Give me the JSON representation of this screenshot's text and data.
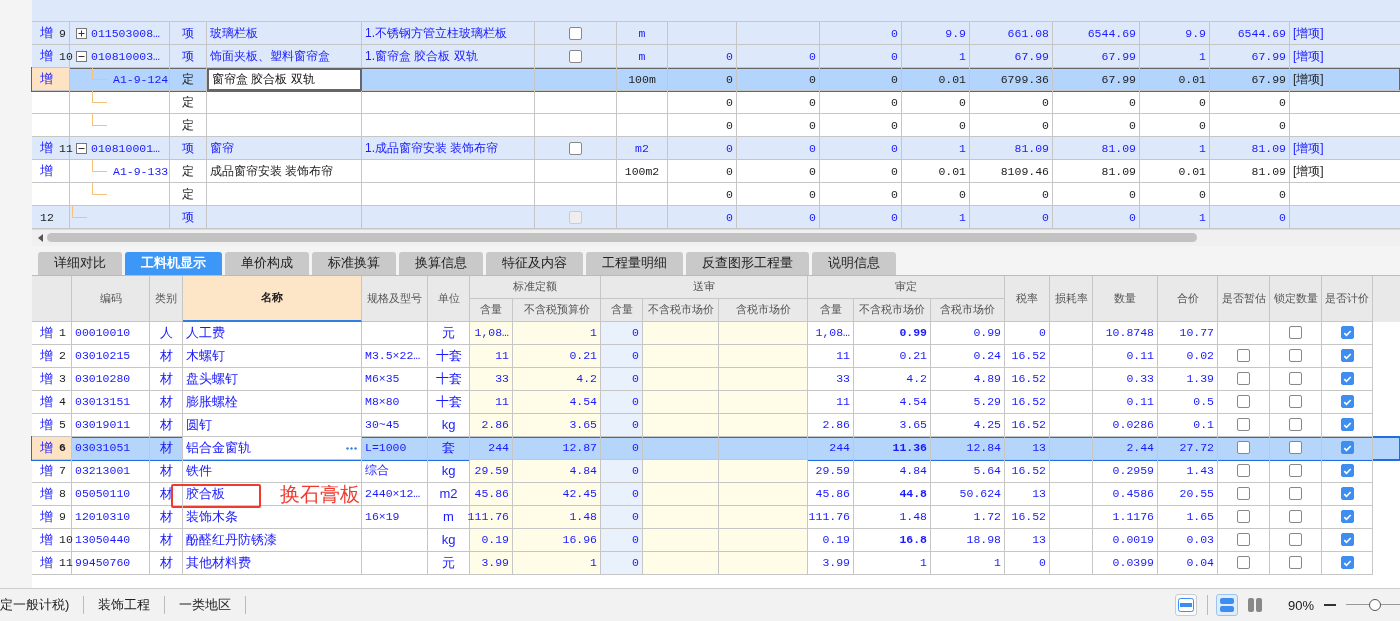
{
  "top_table": {
    "rows": [
      {
        "kind": "bill",
        "mark": "增",
        "no": "9",
        "expanded": false,
        "code": "011503008…",
        "type": "项",
        "name": "玻璃栏板",
        "feature": "1.不锈钢方管立柱玻璃栏板",
        "checkbox": {
          "checked": false,
          "disabled": false
        },
        "unit": "m",
        "values": {
          "column_10": "0",
          "column_11": "9.9",
          "column_12": "661.08",
          "column_13": "6544.69",
          "column_14": "9.9",
          "column_15": "6544.69"
        },
        "tag": "[增项]",
        "selected": false
      },
      {
        "kind": "bill",
        "mark": "增",
        "no": "10",
        "expanded": true,
        "code": "010810003…",
        "type": "项",
        "name": "饰面夹板、塑料窗帘盒",
        "feature": "1.窗帘盒 胶合板 双轨",
        "checkbox": {
          "checked": false,
          "disabled": false
        },
        "unit": "m",
        "values": {
          "column_8": "0",
          "column_9": "0",
          "column_10": "0",
          "column_11": "1",
          "column_12": "67.99",
          "column_13": "67.99",
          "column_14": "1",
          "column_15": "67.99"
        },
        "tag": "[增项]",
        "selected": false
      },
      {
        "kind": "quota",
        "mark": "增",
        "code": "A1-9-124",
        "type": "定",
        "name": "窗帘盒 胶合板 双轨",
        "unit": "100m",
        "values": {
          "column_8": "0",
          "column_9": "0",
          "column_10": "0",
          "column_11": "0.01",
          "column_12": "6799.36",
          "column_13": "67.99",
          "column_14": "0.01",
          "column_15": "67.99"
        },
        "tag": "[增项]",
        "selected": true
      },
      {
        "kind": "quota",
        "type": "定",
        "values": {
          "column_8": "0",
          "column_9": "0",
          "column_10": "0",
          "column_11": "0",
          "column_12": "0",
          "column_13": "0",
          "column_14": "0",
          "column_15": "0"
        },
        "selected": false
      },
      {
        "kind": "quota",
        "type": "定",
        "values": {
          "column_8": "0",
          "column_9": "0",
          "column_10": "0",
          "column_11": "0",
          "column_12": "0",
          "column_13": "0",
          "column_14": "0",
          "column_15": "0"
        },
        "selected": false
      },
      {
        "kind": "bill",
        "mark": "增",
        "no": "11",
        "expanded": true,
        "code": "010810001…",
        "type": "项",
        "name": "窗帘",
        "feature": "1.成品窗帘安装 装饰布帘",
        "checkbox": {
          "checked": false,
          "disabled": false
        },
        "unit": "m2",
        "values": {
          "column_8": "0",
          "column_9": "0",
          "column_10": "0",
          "column_11": "1",
          "column_12": "81.09",
          "column_13": "81.09",
          "column_14": "1",
          "column_15": "81.09"
        },
        "tag": "[增项]",
        "selected": false
      },
      {
        "kind": "quota",
        "mark": "增",
        "code": "A1-9-133",
        "type": "定",
        "name": "成品窗帘安装 装饰布帘",
        "unit": "100m2",
        "values": {
          "column_8": "0",
          "column_9": "0",
          "column_10": "0",
          "column_11": "0.01",
          "column_12": "8109.46",
          "column_13": "81.09",
          "column_14": "0.01",
          "column_15": "81.09"
        },
        "tag": "[增项]",
        "selected": false
      },
      {
        "kind": "quota",
        "type": "定",
        "values": {
          "column_8": "0",
          "column_9": "0",
          "column_10": "0",
          "column_11": "0",
          "column_12": "0",
          "column_13": "0",
          "column_14": "0",
          "column_15": "0"
        },
        "selected": false
      },
      {
        "kind": "bill",
        "no": "12",
        "type": "项",
        "checkbox": {
          "checked": false,
          "disabled": true
        },
        "values": {
          "column_8": "0",
          "column_9": "0",
          "column_10": "0",
          "column_11": "1",
          "column_12": "0",
          "column_13": "0",
          "column_14": "1",
          "column_15": "0"
        },
        "selected": false
      }
    ]
  },
  "tabs": [
    {
      "label": "详细对比",
      "selected": false
    },
    {
      "label": "工料机显示",
      "selected": true
    },
    {
      "label": "单价构成",
      "selected": false
    },
    {
      "label": "标准换算",
      "selected": false
    },
    {
      "label": "换算信息",
      "selected": false
    },
    {
      "label": "特征及内容",
      "selected": false
    },
    {
      "label": "工程量明细",
      "selected": false
    },
    {
      "label": "反查图形工程量",
      "selected": false
    },
    {
      "label": "说明信息",
      "selected": false
    }
  ],
  "detail_table": {
    "columns_before": [
      "编码",
      "类别",
      "名称",
      "规格及型号",
      "单位"
    ],
    "groups": [
      {
        "label": "标准定额",
        "columns": [
          "含量",
          "不含税预算价"
        ]
      },
      {
        "label": "送审",
        "columns": [
          "含量",
          "不含税市场价",
          "含税市场价"
        ]
      },
      {
        "label": "审定",
        "columns": [
          "含量",
          "不含税市场价",
          "含税市场价"
        ]
      }
    ],
    "columns_after": [
      "税率",
      "损耗率",
      "数量",
      "合价",
      "是否暂估",
      "锁定数量",
      "是否计价"
    ],
    "rows": [
      {
        "mark": "增",
        "no": "1",
        "code": "00010010",
        "category": "人",
        "name": "人工费",
        "unit": "元",
        "values": {
          "std_qty": "1,08…",
          "std_price": "1",
          "sub_qty": "0",
          "final_qty": "1,08…",
          "final_price_ex": "0.99",
          "final_price_in": "0.99",
          "tax_rate": "0",
          "quantity": "10.8748",
          "total": "10.77"
        },
        "adjusted": true,
        "locked": false,
        "priced": true,
        "selected": false,
        "highlighted": false
      },
      {
        "mark": "增",
        "no": "2",
        "code": "03010215",
        "category": "材",
        "name": "木螺钉",
        "spec": "M3.5×22…",
        "unit": "十套",
        "values": {
          "std_qty": "11",
          "std_price": "0.21",
          "sub_qty": "0",
          "final_qty": "11",
          "final_price_ex": "0.21",
          "final_price_in": "0.24",
          "tax_rate": "16.52",
          "quantity": "0.11",
          "total": "0.02"
        },
        "adjusted": false,
        "provisional": false,
        "locked": false,
        "priced": true,
        "selected": false,
        "highlighted": false
      },
      {
        "mark": "增",
        "no": "3",
        "code": "03010280",
        "category": "材",
        "name": "盘头螺钉",
        "spec": "M6×35",
        "unit": "十套",
        "values": {
          "std_qty": "33",
          "std_price": "4.2",
          "sub_qty": "0",
          "final_qty": "33",
          "final_price_ex": "4.2",
          "final_price_in": "4.89",
          "tax_rate": "16.52",
          "quantity": "0.33",
          "total": "1.39"
        },
        "adjusted": false,
        "provisional": false,
        "locked": false,
        "priced": true,
        "selected": false,
        "highlighted": false
      },
      {
        "mark": "增",
        "no": "4",
        "code": "03013151",
        "category": "材",
        "name": "膨胀螺栓",
        "spec": "M8×80",
        "unit": "十套",
        "values": {
          "std_qty": "11",
          "std_price": "4.54",
          "sub_qty": "0",
          "final_qty": "11",
          "final_price_ex": "4.54",
          "final_price_in": "5.29",
          "tax_rate": "16.52",
          "quantity": "0.11",
          "total": "0.5"
        },
        "adjusted": false,
        "provisional": false,
        "locked": false,
        "priced": true,
        "selected": false,
        "highlighted": false
      },
      {
        "mark": "增",
        "no": "5",
        "code": "03019011",
        "category": "材",
        "name": "圆钉",
        "spec": "30~45",
        "unit": "kg",
        "values": {
          "std_qty": "2.86",
          "std_price": "3.65",
          "sub_qty": "0",
          "final_qty": "2.86",
          "final_price_ex": "3.65",
          "final_price_in": "4.25",
          "tax_rate": "16.52",
          "quantity": "0.0286",
          "total": "0.1"
        },
        "adjusted": false,
        "provisional": false,
        "locked": false,
        "priced": true,
        "selected": false,
        "highlighted": false
      },
      {
        "mark": "增",
        "no": "6",
        "code": "03031051",
        "category": "材",
        "name": "铝合金窗轨",
        "spec": "L=1000",
        "unit": "套",
        "values": {
          "std_qty": "244",
          "std_price": "12.87",
          "sub_qty": "0",
          "final_qty": "244",
          "final_price_ex": "11.36",
          "final_price_in": "12.84",
          "tax_rate": "13",
          "quantity": "2.44",
          "total": "27.72"
        },
        "adjusted": true,
        "provisional": false,
        "locked": false,
        "priced": true,
        "selected": true,
        "highlighted": false
      },
      {
        "mark": "增",
        "no": "7",
        "code": "03213001",
        "category": "材",
        "name": "铁件",
        "spec": "综合",
        "unit": "kg",
        "values": {
          "std_qty": "29.59",
          "std_price": "4.84",
          "sub_qty": "0",
          "final_qty": "29.59",
          "final_price_ex": "4.84",
          "final_price_in": "5.64",
          "tax_rate": "16.52",
          "quantity": "0.2959",
          "total": "1.43"
        },
        "adjusted": false,
        "provisional": false,
        "locked": false,
        "priced": true,
        "selected": false,
        "highlighted": false
      },
      {
        "mark": "增",
        "no": "8",
        "code": "05050110",
        "category": "材",
        "name": "胶合板",
        "spec": "2440×12…",
        "unit": "m2",
        "values": {
          "std_qty": "45.86",
          "std_price": "42.45",
          "sub_qty": "0",
          "final_qty": "45.86",
          "final_price_ex": "44.8",
          "final_price_in": "50.624",
          "tax_rate": "13",
          "quantity": "0.4586",
          "total": "20.55"
        },
        "adjusted": true,
        "provisional": false,
        "locked": false,
        "priced": true,
        "selected": false,
        "highlighted": true
      },
      {
        "mark": "增",
        "no": "9",
        "code": "12010310",
        "category": "材",
        "name": "装饰木条",
        "spec": "16×19",
        "unit": "m",
        "values": {
          "std_qty": "111.76",
          "std_price": "1.48",
          "sub_qty": "0",
          "final_qty": "111.76",
          "final_price_ex": "1.48",
          "final_price_in": "1.72",
          "tax_rate": "16.52",
          "quantity": "1.1176",
          "total": "1.65"
        },
        "adjusted": false,
        "provisional": false,
        "locked": false,
        "priced": true,
        "selected": false,
        "highlighted": false
      },
      {
        "mark": "增",
        "no": "10",
        "code": "13050440",
        "category": "材",
        "name": "酚醛红丹防锈漆",
        "unit": "kg",
        "values": {
          "std_qty": "0.19",
          "std_price": "16.96",
          "sub_qty": "0",
          "final_qty": "0.19",
          "final_price_ex": "16.8",
          "final_price_in": "18.98",
          "tax_rate": "13",
          "quantity": "0.0019",
          "total": "0.03"
        },
        "adjusted": true,
        "provisional": false,
        "locked": false,
        "priced": true,
        "selected": false,
        "highlighted": false
      },
      {
        "mark": "增",
        "no": "11",
        "code": "99450760",
        "category": "材",
        "name": "其他材料费",
        "unit": "元",
        "values": {
          "std_qty": "3.99",
          "std_price": "1",
          "sub_qty": "0",
          "final_qty": "3.99",
          "final_price_ex": "1",
          "final_price_in": "1",
          "tax_rate": "0",
          "quantity": "0.0399",
          "total": "0.04"
        },
        "adjusted": false,
        "provisional": false,
        "locked": false,
        "priced": true,
        "selected": false,
        "highlighted": false
      }
    ]
  },
  "annotation": {
    "text": "换石膏板"
  },
  "status_bar": {
    "items": [
      "定一般计税)",
      "装饰工程",
      "一类地区"
    ],
    "views": [
      {
        "kind": "single",
        "selected": false
      },
      {
        "kind": "stacked",
        "selected": true
      },
      {
        "kind": "split",
        "selected": false
      }
    ],
    "zoom": {
      "reading": "90%",
      "level": 0.55
    }
  }
}
